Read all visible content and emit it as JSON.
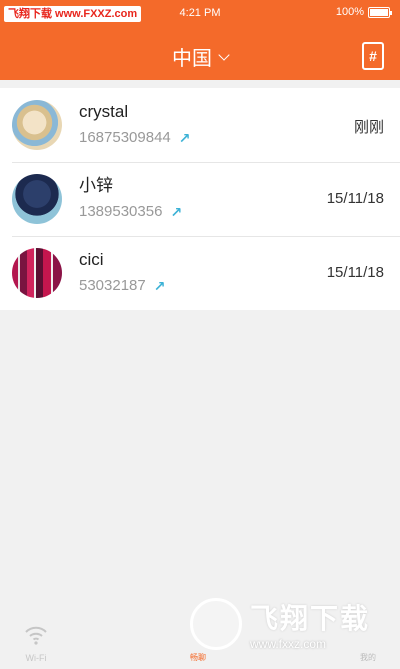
{
  "status_bar": {
    "watermark": "飞翔下载 www.FXXZ.com",
    "time": "4:21 PM",
    "battery": "100%"
  },
  "nav": {
    "title": "中国"
  },
  "contacts": [
    {
      "name": "crystal",
      "number": "16875309844",
      "time": "刚刚"
    },
    {
      "name": "小锌",
      "number": "1389530356",
      "time": "15/11/18"
    },
    {
      "name": "cici",
      "number": "53032187",
      "time": "15/11/18"
    }
  ],
  "tabs": {
    "wifi": "Wi-Fi",
    "call": "畅聊",
    "me": "我的"
  },
  "watermark_br": {
    "big": "飞翔下载",
    "small": "www.fxxz.com"
  },
  "colors": {
    "brand": "#f46a2a",
    "accent_arrow": "#3cb2d6"
  }
}
